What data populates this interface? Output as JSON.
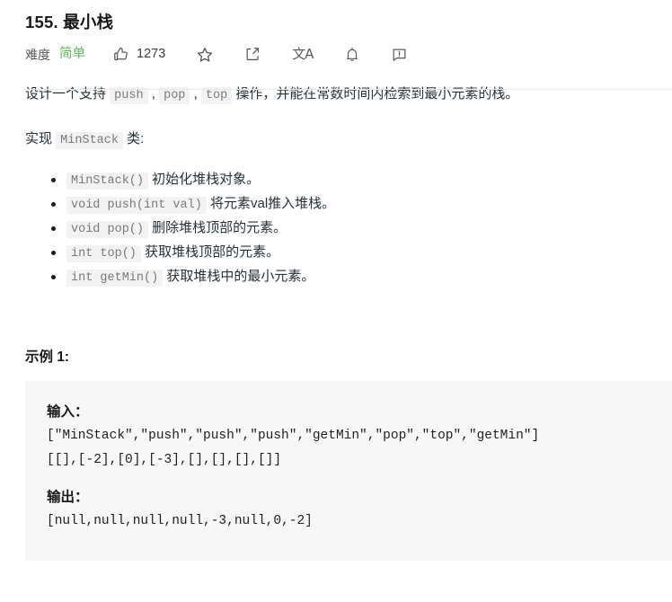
{
  "problem": {
    "title": "155. 最小栈",
    "difficulty_label": "难度",
    "difficulty_value": "简单",
    "difficulty_color": "#5cb85c",
    "like_count": "1273"
  },
  "toolbar": {
    "like_icon": "thumbs-up-icon",
    "favorite_icon": "star-icon",
    "share_icon": "share-icon",
    "translate_icon": "translate-icon",
    "translate_glyph": "文A",
    "notification_icon": "bell-icon",
    "feedback_icon": "feedback-icon"
  },
  "description": {
    "paragraph1_part1": "设计一个支持 ",
    "paragraph1_code1": "push",
    "paragraph1_sep1": " , ",
    "paragraph1_code2": "pop",
    "paragraph1_sep2": " , ",
    "paragraph1_code3": "top",
    "paragraph1_part2": " 操作，并能在常数时间内检索到最小元素的栈。",
    "paragraph2_part1": "实现 ",
    "paragraph2_code": "MinStack",
    "paragraph2_part2": " 类:"
  },
  "api_list": [
    {
      "code": "MinStack()",
      "text": " 初始化堆栈对象。"
    },
    {
      "code": "void push(int val)",
      "text": " 将元素val推入堆栈。"
    },
    {
      "code": "void pop()",
      "text": " 删除堆栈顶部的元素。"
    },
    {
      "code": "int top()",
      "text": " 获取堆栈顶部的元素。"
    },
    {
      "code": "int getMin()",
      "text": " 获取堆栈中的最小元素。"
    }
  ],
  "example": {
    "heading": "示例 1:",
    "input_label": "输入：",
    "input_line1": "[\"MinStack\",\"push\",\"push\",\"push\",\"getMin\",\"pop\",\"top\",\"getMin\"]",
    "input_line2": "[[],[-2],[0],[-3],[],[],[],[]]",
    "output_label": "输出：",
    "output_line1": "[null,null,null,null,-3,null,0,-2]"
  }
}
